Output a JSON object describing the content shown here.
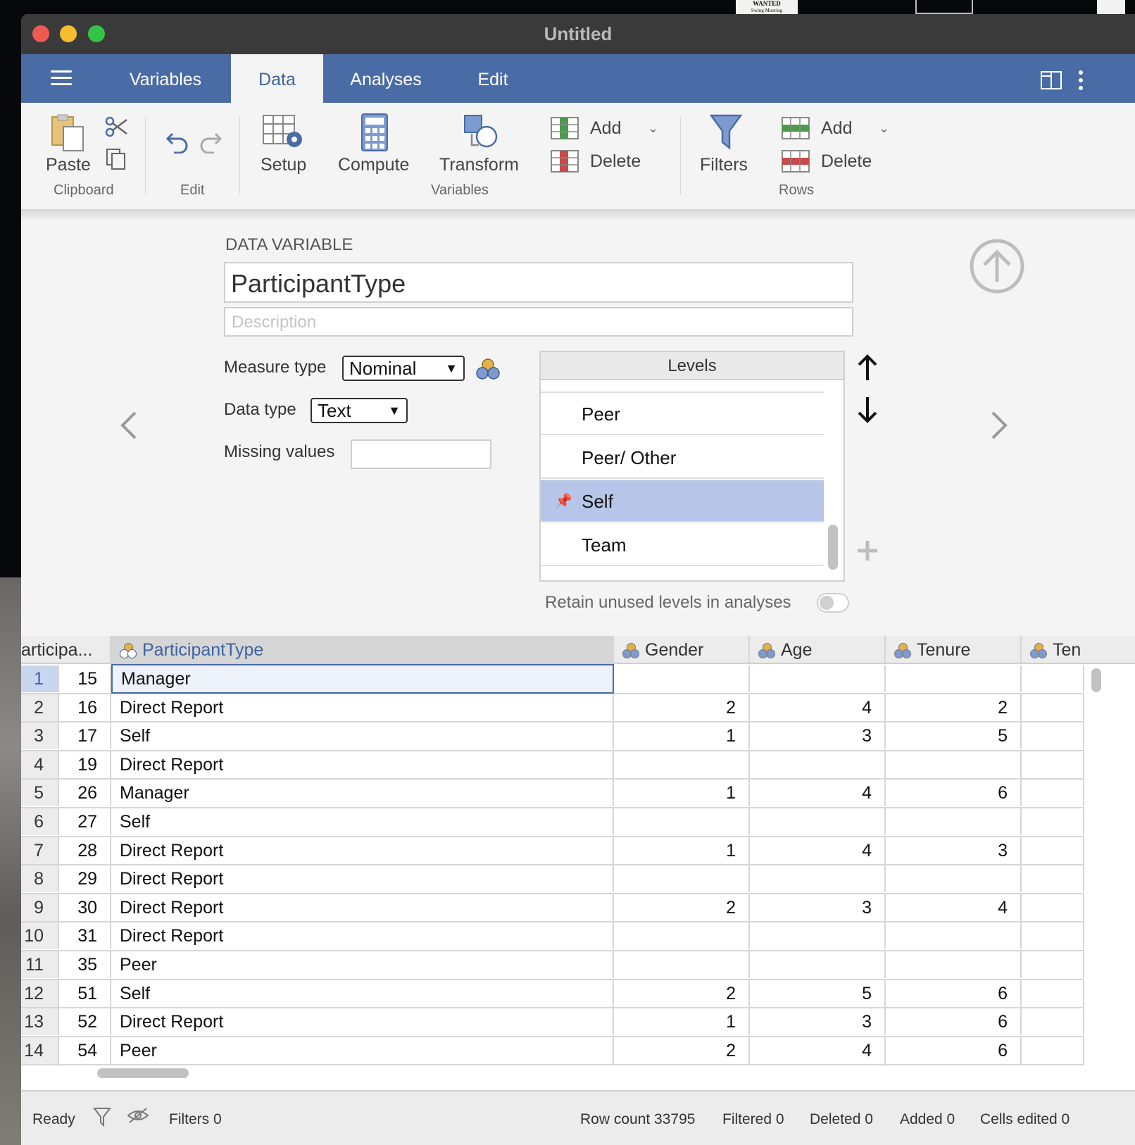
{
  "window": {
    "title": "Untitled"
  },
  "desktop": {
    "thumb_text": "WANTED",
    "thumb_sub": "Swing Mooring"
  },
  "tabs": [
    {
      "label": "Variables"
    },
    {
      "label": "Data"
    },
    {
      "label": "Analyses"
    },
    {
      "label": "Edit"
    }
  ],
  "ribbon": {
    "paste": "Paste",
    "clipboard_group": "Clipboard",
    "edit_group": "Edit",
    "setup": "Setup",
    "compute": "Compute",
    "transform": "Transform",
    "var_add": "Add",
    "var_delete": "Delete",
    "variables_group": "Variables",
    "filters": "Filters",
    "row_add": "Add",
    "row_delete": "Delete",
    "rows_group": "Rows"
  },
  "editor": {
    "heading": "DATA VARIABLE",
    "name": "ParticipantType",
    "description_placeholder": "Description",
    "measure_type_label": "Measure type",
    "measure_type_value": "Nominal",
    "data_type_label": "Data type",
    "data_type_value": "Text",
    "missing_values_label": "Missing values",
    "levels_title": "Levels",
    "levels": [
      "Peer",
      "Peer/ Other",
      "Self",
      "Team"
    ],
    "selected_level": "Self",
    "retain_label": "Retain unused levels in analyses",
    "retain_on": false
  },
  "grid": {
    "columns": [
      "articipa...",
      "ParticipantType",
      "Gender",
      "Age",
      "Tenure",
      "Ten"
    ],
    "rows": [
      [
        "1",
        "15",
        "Manager",
        "",
        "",
        ""
      ],
      [
        "2",
        "16",
        "Direct Report",
        "2",
        "4",
        "2"
      ],
      [
        "3",
        "17",
        "Self",
        "1",
        "3",
        "5"
      ],
      [
        "4",
        "19",
        "Direct Report",
        "",
        "",
        ""
      ],
      [
        "5",
        "26",
        "Manager",
        "1",
        "4",
        "6"
      ],
      [
        "6",
        "27",
        "Self",
        "",
        "",
        ""
      ],
      [
        "7",
        "28",
        "Direct Report",
        "1",
        "4",
        "3"
      ],
      [
        "8",
        "29",
        "Direct Report",
        "",
        "",
        ""
      ],
      [
        "9",
        "30",
        "Direct Report",
        "2",
        "3",
        "4"
      ],
      [
        "10",
        "31",
        "Direct Report",
        "",
        "",
        ""
      ],
      [
        "11",
        "35",
        "Peer",
        "",
        "",
        ""
      ],
      [
        "12",
        "51",
        "Self",
        "2",
        "5",
        "6"
      ],
      [
        "13",
        "52",
        "Direct Report",
        "1",
        "3",
        "6"
      ],
      [
        "14",
        "54",
        "Peer",
        "2",
        "4",
        "6"
      ]
    ]
  },
  "status": {
    "ready": "Ready",
    "filters": "Filters 0",
    "row_count": "Row count 33795",
    "filtered": "Filtered 0",
    "deleted": "Deleted 0",
    "added": "Added 0",
    "cells_edited": "Cells edited 0"
  },
  "colors": {
    "accent": "#4a6ca6",
    "selected_level": "#b7c6e8",
    "active_tab_text": "#3e63a0"
  }
}
